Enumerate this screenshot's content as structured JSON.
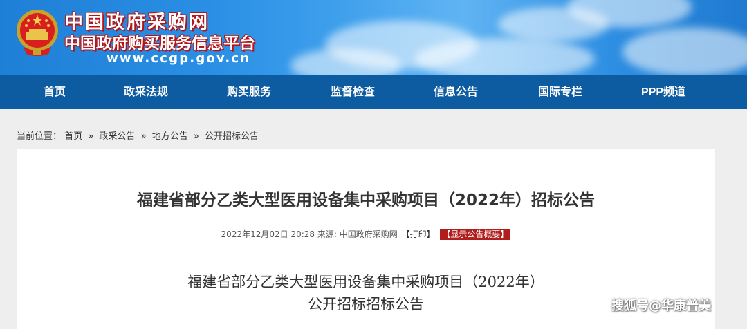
{
  "banner": {
    "title_main": "中国政府采购网",
    "title_sub": "中国政府购买服务信息平台",
    "url": "www.ccgp.gov.cn",
    "emblem_icon": "national-emblem-icon",
    "colors": {
      "sky": "#2a8fe4",
      "title_outline": "#b51416"
    }
  },
  "nav": {
    "color": "#0d5ba0",
    "items": [
      {
        "label": "首页"
      },
      {
        "label": "政采法规"
      },
      {
        "label": "购买服务"
      },
      {
        "label": "监督检查"
      },
      {
        "label": "信息公告"
      },
      {
        "label": "国际专栏"
      },
      {
        "label": "PPP频道"
      }
    ]
  },
  "breadcrumb": {
    "prefix": "当前位置：",
    "items": [
      "首页",
      "政采公告",
      "地方公告",
      "公开招标公告"
    ],
    "separator": "»"
  },
  "article": {
    "title": "福建省部分乙类大型医用设备集中采购项目（2022年）招标公告",
    "date": "2022年12月02日 20:28",
    "source_label": "来源:",
    "source": "中国政府采购网",
    "print_label": "【打印】",
    "summary_label": "【显示公告概要】",
    "summary_color": "#b11c1c",
    "doc_title_line1": "福建省部分乙类大型医用设备集中采购项目（2022年）",
    "doc_title_line2": "公开招标招标公告"
  },
  "watermark": "搜狐号@华康普美"
}
